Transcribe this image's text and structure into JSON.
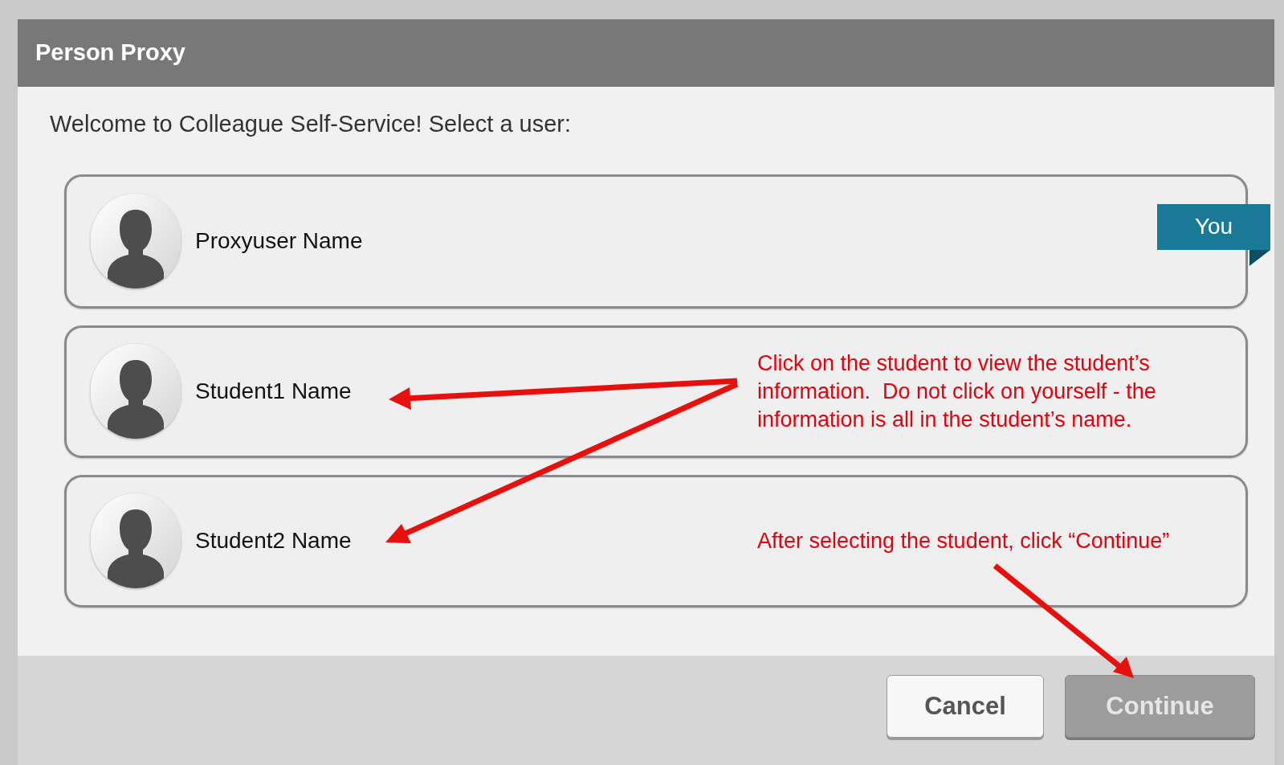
{
  "dialog": {
    "title": "Person Proxy",
    "prompt": "Welcome to Colleague Self-Service! Select a user:"
  },
  "users": [
    {
      "name": "Proxyuser Name",
      "badge": "You"
    },
    {
      "name": "Student1 Name",
      "note": "Click on the student to view the student’s information.  Do not click on yourself - the information is all in the student’s name."
    },
    {
      "name": "Student2 Name",
      "note": "After selecting the student, click “Continue”"
    }
  ],
  "buttons": [
    {
      "label": "Cancel",
      "disabled": false
    },
    {
      "label": "Continue",
      "disabled": true
    }
  ]
}
